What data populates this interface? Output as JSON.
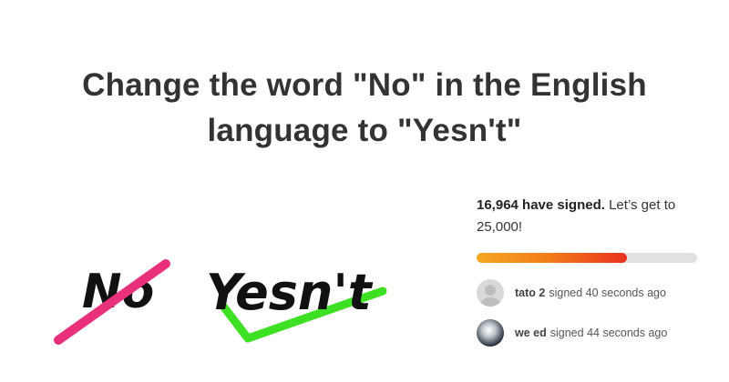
{
  "petition": {
    "title_line1": "Change the word \"No\" in the English",
    "title_line2": "language to \"Yesn't\""
  },
  "hero": {
    "crossed_word": "No",
    "new_word": "Yesn't",
    "strike_color": "#e8317a",
    "check_color": "#3ee024"
  },
  "progress": {
    "signed_count_text": "16,964 have signed.",
    "goal_text": "Let’s get to 25,000!",
    "signed": 16964,
    "goal": 25000,
    "fraction": 0.68
  },
  "signers": [
    {
      "name": "tato 2",
      "action": "signed",
      "time": "40 seconds ago",
      "avatar": "default-avatar"
    },
    {
      "name": "we ed",
      "action": "signed",
      "time": "44 seconds ago",
      "avatar": "photo-avatar"
    }
  ]
}
